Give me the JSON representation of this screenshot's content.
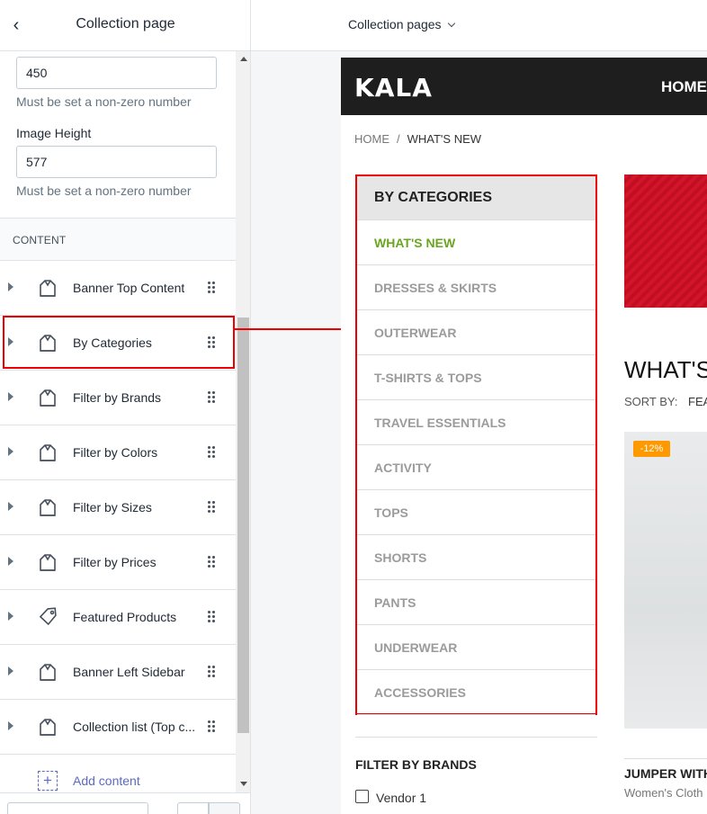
{
  "left_panel": {
    "title": "Collection page",
    "image_width_value": "450",
    "image_width_help": "Must be set a non-zero number",
    "image_height_label": "Image Height",
    "image_height_value": "577",
    "image_height_help": "Must be set a non-zero number",
    "content_section_label": "CONTENT",
    "sections": [
      {
        "label": "Banner Top Content",
        "icon": "section-icon"
      },
      {
        "label": "By Categories",
        "icon": "section-icon"
      },
      {
        "label": "Filter by Brands",
        "icon": "section-icon"
      },
      {
        "label": "Filter by Colors",
        "icon": "section-icon"
      },
      {
        "label": "Filter by Sizes",
        "icon": "section-icon"
      },
      {
        "label": "Filter by Prices",
        "icon": "section-icon"
      },
      {
        "label": "Featured Products",
        "icon": "tag-icon"
      },
      {
        "label": "Banner Left Sidebar",
        "icon": "section-icon"
      },
      {
        "label": "Collection list (Top c...",
        "icon": "section-icon"
      }
    ],
    "add_content_label": "Add content"
  },
  "topbar": {
    "page_selector": "Collection pages"
  },
  "preview": {
    "logo": "KALA",
    "nav_home": "HOME",
    "breadcrumb_home": "HOME",
    "breadcrumb_sep": "/",
    "breadcrumb_current": "WHAT'S NEW",
    "categories_title": "BY CATEGORIES",
    "categories": [
      "WHAT'S NEW",
      "DRESSES & SKIRTS",
      "OUTERWEAR",
      "T-SHIRTS & TOPS",
      "TRAVEL ESSENTIALS",
      "ACTIVITY",
      "TOPS",
      "SHORTS",
      "PANTS",
      "UNDERWEAR",
      "ACCESSORIES"
    ],
    "active_category": "WHAT'S NEW",
    "filter_brands_title": "FILTER BY BRANDS",
    "vendor_label": "Vendor 1",
    "collection_title": "WHAT'S",
    "sort_label": "SORT BY:",
    "sort_value": "FEA",
    "discount_badge": "-12%",
    "product_name": "JUMPER WITH",
    "product_type": "Women's Cloth"
  },
  "colors": {
    "highlight": "#e00000",
    "active_category": "#6aa520",
    "store_header": "#1e1e1e",
    "badge": "#ff9900",
    "accent": "#5c6ac4"
  }
}
